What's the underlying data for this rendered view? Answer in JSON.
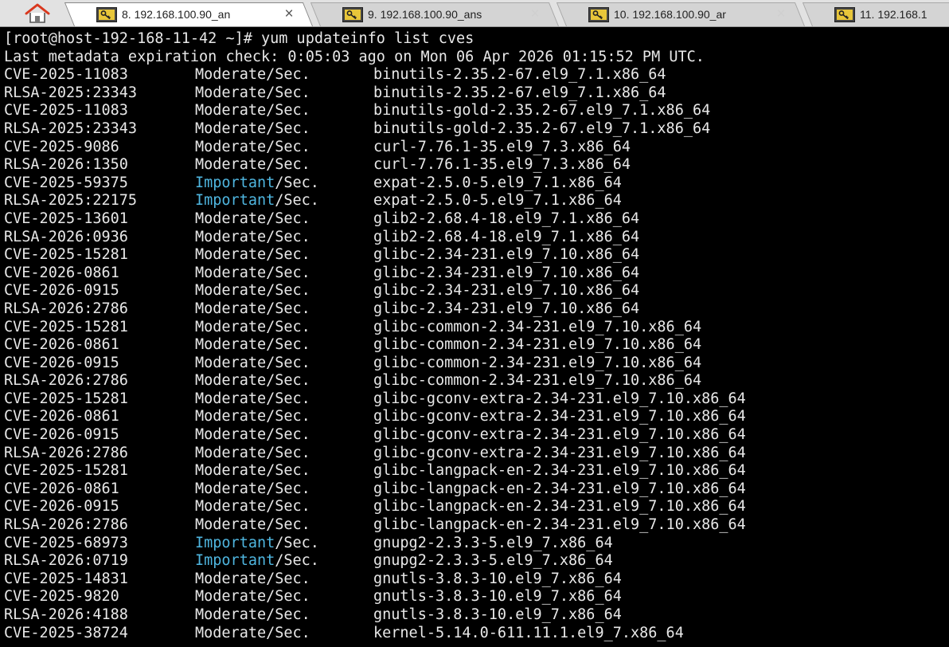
{
  "colors": {
    "terminal_bg": "#000000",
    "terminal_fg": "#e8e8e8",
    "important_severity": "#4fb6e0",
    "tab_icon_bg": "#e8c63a"
  },
  "tabs": [
    {
      "label": "8. 192.168.100.90_an",
      "icon": "key-icon",
      "active": true
    },
    {
      "label": "9. 192.168.100.90_ans",
      "icon": "key-icon",
      "active": false
    },
    {
      "label": "10. 192.168.100.90_ar",
      "icon": "key-icon",
      "active": false
    },
    {
      "label": "11. 192.168.1",
      "icon": "key-icon",
      "active": false
    }
  ],
  "terminal": {
    "prompt": "[root@host-192-168-11-42 ~]# yum updateinfo list cves",
    "metadata": "Last metadata expiration check: 0:05:03 ago on Mon 06 Apr 2026 01:15:52 PM UTC.",
    "entries": [
      {
        "id": "CVE-2025-11083",
        "severity": "Moderate",
        "suffix": "/Sec.",
        "package": "binutils-2.35.2-67.el9_7.1.x86_64"
      },
      {
        "id": "RLSA-2025:23343",
        "severity": "Moderate",
        "suffix": "/Sec.",
        "package": "binutils-2.35.2-67.el9_7.1.x86_64"
      },
      {
        "id": "CVE-2025-11083",
        "severity": "Moderate",
        "suffix": "/Sec.",
        "package": "binutils-gold-2.35.2-67.el9_7.1.x86_64"
      },
      {
        "id": "RLSA-2025:23343",
        "severity": "Moderate",
        "suffix": "/Sec.",
        "package": "binutils-gold-2.35.2-67.el9_7.1.x86_64"
      },
      {
        "id": "CVE-2025-9086",
        "severity": "Moderate",
        "suffix": "/Sec.",
        "package": "curl-7.76.1-35.el9_7.3.x86_64"
      },
      {
        "id": "RLSA-2026:1350",
        "severity": "Moderate",
        "suffix": "/Sec.",
        "package": "curl-7.76.1-35.el9_7.3.x86_64"
      },
      {
        "id": "CVE-2025-59375",
        "severity": "Important",
        "suffix": "/Sec.",
        "package": "expat-2.5.0-5.el9_7.1.x86_64"
      },
      {
        "id": "RLSA-2025:22175",
        "severity": "Important",
        "suffix": "/Sec.",
        "package": "expat-2.5.0-5.el9_7.1.x86_64"
      },
      {
        "id": "CVE-2025-13601",
        "severity": "Moderate",
        "suffix": "/Sec.",
        "package": "glib2-2.68.4-18.el9_7.1.x86_64"
      },
      {
        "id": "RLSA-2026:0936",
        "severity": "Moderate",
        "suffix": "/Sec.",
        "package": "glib2-2.68.4-18.el9_7.1.x86_64"
      },
      {
        "id": "CVE-2025-15281",
        "severity": "Moderate",
        "suffix": "/Sec.",
        "package": "glibc-2.34-231.el9_7.10.x86_64"
      },
      {
        "id": "CVE-2026-0861",
        "severity": "Moderate",
        "suffix": "/Sec.",
        "package": "glibc-2.34-231.el9_7.10.x86_64"
      },
      {
        "id": "CVE-2026-0915",
        "severity": "Moderate",
        "suffix": "/Sec.",
        "package": "glibc-2.34-231.el9_7.10.x86_64"
      },
      {
        "id": "RLSA-2026:2786",
        "severity": "Moderate",
        "suffix": "/Sec.",
        "package": "glibc-2.34-231.el9_7.10.x86_64"
      },
      {
        "id": "CVE-2025-15281",
        "severity": "Moderate",
        "suffix": "/Sec.",
        "package": "glibc-common-2.34-231.el9_7.10.x86_64"
      },
      {
        "id": "CVE-2026-0861",
        "severity": "Moderate",
        "suffix": "/Sec.",
        "package": "glibc-common-2.34-231.el9_7.10.x86_64"
      },
      {
        "id": "CVE-2026-0915",
        "severity": "Moderate",
        "suffix": "/Sec.",
        "package": "glibc-common-2.34-231.el9_7.10.x86_64"
      },
      {
        "id": "RLSA-2026:2786",
        "severity": "Moderate",
        "suffix": "/Sec.",
        "package": "glibc-common-2.34-231.el9_7.10.x86_64"
      },
      {
        "id": "CVE-2025-15281",
        "severity": "Moderate",
        "suffix": "/Sec.",
        "package": "glibc-gconv-extra-2.34-231.el9_7.10.x86_64"
      },
      {
        "id": "CVE-2026-0861",
        "severity": "Moderate",
        "suffix": "/Sec.",
        "package": "glibc-gconv-extra-2.34-231.el9_7.10.x86_64"
      },
      {
        "id": "CVE-2026-0915",
        "severity": "Moderate",
        "suffix": "/Sec.",
        "package": "glibc-gconv-extra-2.34-231.el9_7.10.x86_64"
      },
      {
        "id": "RLSA-2026:2786",
        "severity": "Moderate",
        "suffix": "/Sec.",
        "package": "glibc-gconv-extra-2.34-231.el9_7.10.x86_64"
      },
      {
        "id": "CVE-2025-15281",
        "severity": "Moderate",
        "suffix": "/Sec.",
        "package": "glibc-langpack-en-2.34-231.el9_7.10.x86_64"
      },
      {
        "id": "CVE-2026-0861",
        "severity": "Moderate",
        "suffix": "/Sec.",
        "package": "glibc-langpack-en-2.34-231.el9_7.10.x86_64"
      },
      {
        "id": "CVE-2026-0915",
        "severity": "Moderate",
        "suffix": "/Sec.",
        "package": "glibc-langpack-en-2.34-231.el9_7.10.x86_64"
      },
      {
        "id": "RLSA-2026:2786",
        "severity": "Moderate",
        "suffix": "/Sec.",
        "package": "glibc-langpack-en-2.34-231.el9_7.10.x86_64"
      },
      {
        "id": "CVE-2025-68973",
        "severity": "Important",
        "suffix": "/Sec.",
        "package": "gnupg2-2.3.3-5.el9_7.x86_64"
      },
      {
        "id": "RLSA-2026:0719",
        "severity": "Important",
        "suffix": "/Sec.",
        "package": "gnupg2-2.3.3-5.el9_7.x86_64"
      },
      {
        "id": "CVE-2025-14831",
        "severity": "Moderate",
        "suffix": "/Sec.",
        "package": "gnutls-3.8.3-10.el9_7.x86_64"
      },
      {
        "id": "CVE-2025-9820",
        "severity": "Moderate",
        "suffix": "/Sec.",
        "package": "gnutls-3.8.3-10.el9_7.x86_64"
      },
      {
        "id": "RLSA-2026:4188",
        "severity": "Moderate",
        "suffix": "/Sec.",
        "package": "gnutls-3.8.3-10.el9_7.x86_64"
      },
      {
        "id": "CVE-2025-38724",
        "severity": "Moderate",
        "suffix": "/Sec.",
        "package": "kernel-5.14.0-611.11.1.el9_7.x86_64"
      }
    ]
  }
}
